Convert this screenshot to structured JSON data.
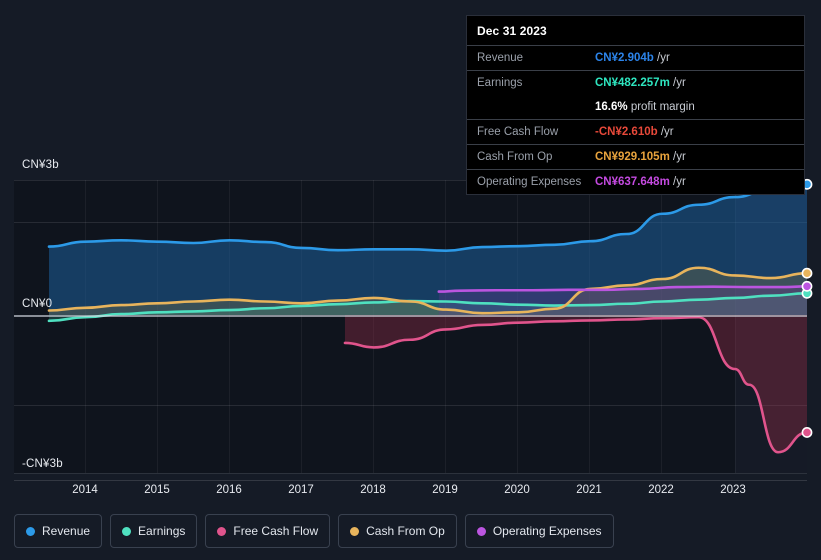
{
  "theme": {
    "background": "#151b26",
    "plot_background": "#0f141d",
    "axis_text": "#e8ebf0",
    "tooltip_background": "#000000"
  },
  "tooltip": {
    "name": "chart-tooltip",
    "title": "Dec 31 2023",
    "rows": [
      {
        "label": "Revenue",
        "value": "CN¥2.904b",
        "unit": "/yr",
        "color": "#2c84ea"
      },
      {
        "label": "Earnings",
        "value": "CN¥482.257m",
        "unit": "/yr",
        "color": "#2ee6c0"
      },
      {
        "label": "",
        "value": "16.6%",
        "unit": "profit margin",
        "color": "#ffffff"
      },
      {
        "label": "Free Cash Flow",
        "value": "-CN¥2.610b",
        "unit": "/yr",
        "color": "#e8493a"
      },
      {
        "label": "Cash From Op",
        "value": "CN¥929.105m",
        "unit": "/yr",
        "color": "#e8a33d"
      },
      {
        "label": "Operating Expenses",
        "value": "CN¥637.648m",
        "unit": "/yr",
        "color": "#c44ae0"
      }
    ]
  },
  "legend": {
    "items": [
      {
        "label": "Revenue",
        "color": "#2c9ae8"
      },
      {
        "label": "Earnings",
        "color": "#4fe0c0"
      },
      {
        "label": "Free Cash Flow",
        "color": "#e0548c"
      },
      {
        "label": "Cash From Op",
        "color": "#e8b45c"
      },
      {
        "label": "Operating Expenses",
        "color": "#bb55e0"
      }
    ]
  },
  "chart_data": {
    "type": "area",
    "title": "",
    "xlabel": "",
    "ylabel": "CN¥",
    "currency": "CN¥",
    "x_ticks": [
      "2014",
      "2015",
      "2016",
      "2017",
      "2018",
      "2019",
      "2020",
      "2021",
      "2022",
      "2023"
    ],
    "y_ticks": [
      "CN¥3b",
      "CN¥0",
      "-CN¥3b"
    ],
    "y_tick_values": [
      3000000000,
      0,
      -3000000000
    ],
    "ylim": [
      -3400000000,
      3400000000
    ],
    "grid": true,
    "legend_position": "bottom-left",
    "highlight_period": "2023",
    "series": [
      {
        "name": "Revenue",
        "color": "#2c9ae8",
        "fill": "rgba(30,95,155,0.55)",
        "end_value": "CN¥2.904b",
        "x": [
          2013.5,
          2014,
          2014.5,
          2015,
          2015.5,
          2016,
          2016.5,
          2017,
          2017.5,
          2018,
          2018.5,
          2019,
          2019.5,
          2020,
          2020.5,
          2021,
          2021.5,
          2022,
          2022.5,
          2023,
          2023.5,
          2024
        ],
        "values": [
          1.52,
          1.63,
          1.66,
          1.63,
          1.6,
          1.66,
          1.62,
          1.49,
          1.44,
          1.46,
          1.46,
          1.43,
          1.51,
          1.53,
          1.56,
          1.64,
          1.8,
          2.25,
          2.45,
          2.62,
          2.8,
          2.904
        ]
      },
      {
        "name": "Earnings",
        "color": "#4fe0c0",
        "fill": "rgba(60,190,165,0.22)",
        "end_value": "CN¥482.257m",
        "x": [
          2013.5,
          2014,
          2014.5,
          2015,
          2015.5,
          2016,
          2016.5,
          2017,
          2017.5,
          2018,
          2018.5,
          2019,
          2019.5,
          2020,
          2020.5,
          2021,
          2021.5,
          2022,
          2022.5,
          2023,
          2023.5,
          2024
        ],
        "values": [
          -0.13,
          -0.05,
          0.02,
          0.06,
          0.08,
          0.11,
          0.15,
          0.2,
          0.24,
          0.28,
          0.31,
          0.3,
          0.26,
          0.23,
          0.21,
          0.22,
          0.25,
          0.3,
          0.34,
          0.38,
          0.43,
          0.482
        ]
      },
      {
        "name": "Free Cash Flow",
        "color": "#e0548c",
        "fill": "rgba(150,45,70,0.38)",
        "end_value": "-CN¥2.610b",
        "x": [
          2017.6,
          2018,
          2018.5,
          2019,
          2019.5,
          2020,
          2020.5,
          2021,
          2021.5,
          2022,
          2022.5,
          2023,
          2023.2,
          2023.6,
          2024
        ],
        "values": [
          -0.62,
          -0.72,
          -0.55,
          -0.32,
          -0.22,
          -0.17,
          -0.14,
          -0.12,
          -0.1,
          -0.07,
          -0.05,
          -1.2,
          -1.55,
          -3.05,
          -2.61
        ]
      },
      {
        "name": "Cash From Op",
        "color": "#e8b45c",
        "fill": "rgba(150,125,60,0.28)",
        "end_value": "CN¥929.105m",
        "x": [
          2013.5,
          2014,
          2014.5,
          2015,
          2015.5,
          2016,
          2016.5,
          2017,
          2017.5,
          2018,
          2018.5,
          2019,
          2019.5,
          2020,
          2020.5,
          2021,
          2021.5,
          2022,
          2022.5,
          2023,
          2023.5,
          2024
        ],
        "values": [
          0.1,
          0.16,
          0.22,
          0.26,
          0.3,
          0.34,
          0.3,
          0.26,
          0.32,
          0.38,
          0.3,
          0.12,
          0.04,
          0.06,
          0.14,
          0.58,
          0.66,
          0.8,
          1.05,
          0.88,
          0.82,
          0.929
        ]
      },
      {
        "name": "Operating Expenses",
        "color": "#bb55e0",
        "fill": "rgba(110,55,150,0.30)",
        "end_value": "CN¥637.648m",
        "x": [
          2018.9,
          2019.2,
          2019.7,
          2020.2,
          2020.7,
          2021.2,
          2021.7,
          2022.2,
          2022.7,
          2023.2,
          2023.7,
          2024
        ],
        "values": [
          0.52,
          0.54,
          0.55,
          0.55,
          0.56,
          0.56,
          0.58,
          0.62,
          0.63,
          0.62,
          0.62,
          0.638
        ]
      }
    ]
  }
}
